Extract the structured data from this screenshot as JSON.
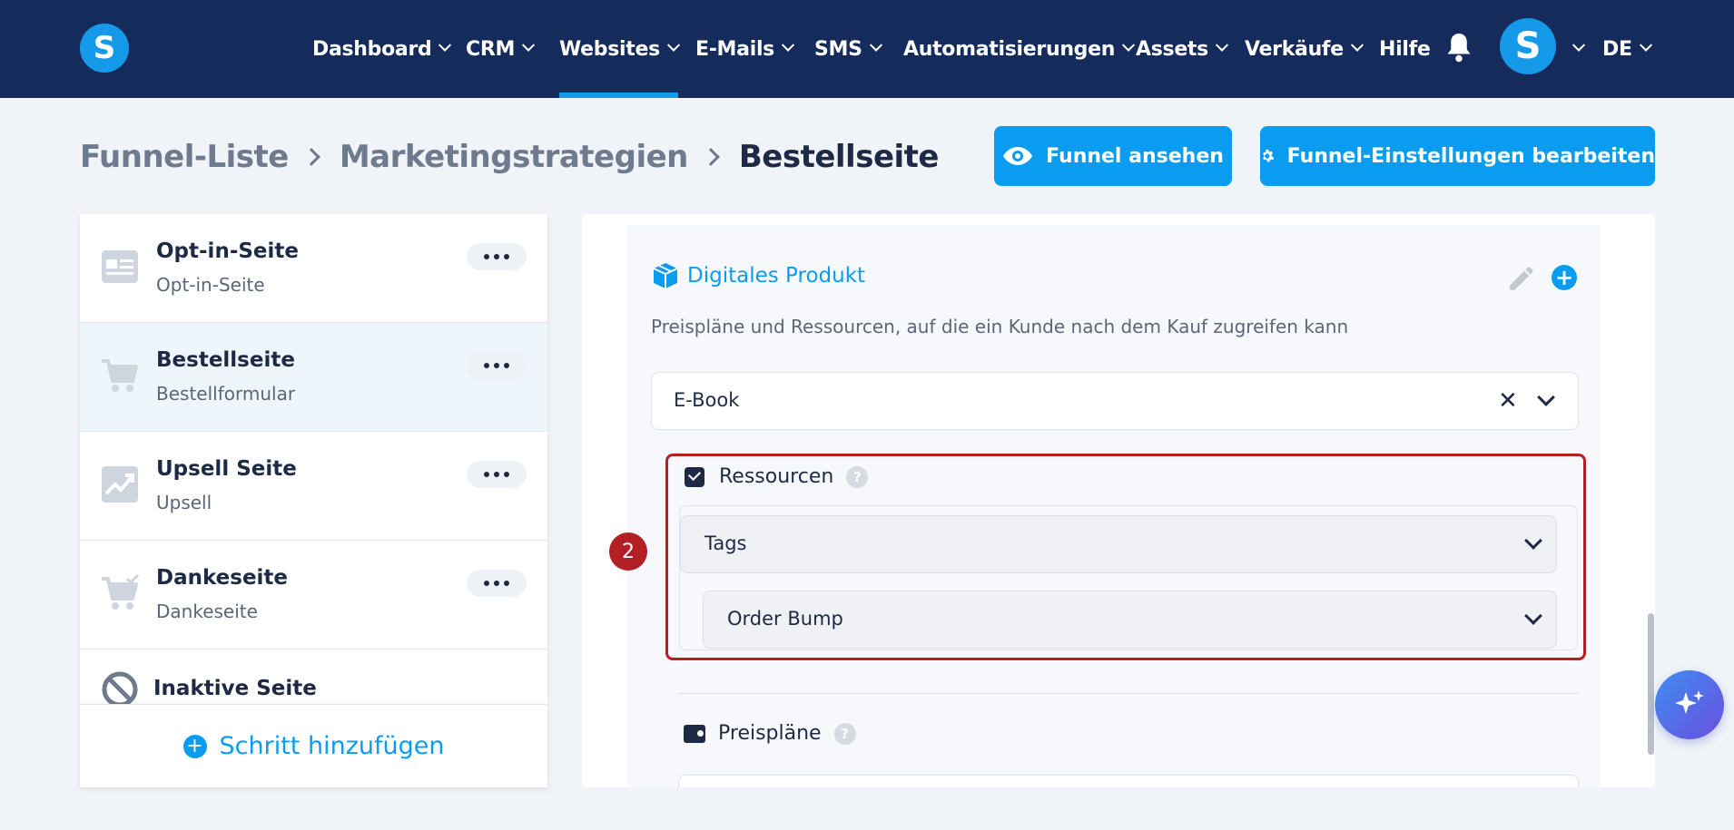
{
  "nav": {
    "logo": "S",
    "items": [
      {
        "label": "Dashboard"
      },
      {
        "label": "CRM"
      },
      {
        "label": "Websites"
      },
      {
        "label": "E-Mails"
      },
      {
        "label": "SMS"
      },
      {
        "label": "Automatisierungen"
      },
      {
        "label": "Assets"
      },
      {
        "label": "Verkäufe"
      },
      {
        "label": "Hilfe"
      }
    ],
    "active": "Websites",
    "avatar": "S",
    "language": "DE"
  },
  "breadcrumb": {
    "items": [
      "Funnel-Liste",
      "Marketingstrategien"
    ],
    "current": "Bestellseite"
  },
  "actions": {
    "view_funnel": "Funnel ansehen",
    "edit_settings": "Funnel-Einstellungen bearbeiten"
  },
  "steps": [
    {
      "title": "Opt-in-Seite",
      "subtitle": "Opt-in-Seite",
      "icon": "form-page-icon"
    },
    {
      "title": "Bestellseite",
      "subtitle": "Bestellformular",
      "icon": "cart-icon",
      "active": true
    },
    {
      "title": "Upsell Seite",
      "subtitle": "Upsell",
      "icon": "trending-up-icon"
    },
    {
      "title": "Dankeseite",
      "subtitle": "Dankeseite",
      "icon": "cart-check-icon"
    },
    {
      "title": "Inaktive Seite",
      "subtitle": "",
      "icon": "ban-icon"
    }
  ],
  "add_step_label": "Schritt hinzufügen",
  "product_section": {
    "title": "Digitales Produkt",
    "description": "Preispläne und Ressourcen, auf die ein Kunde nach dem Kauf zugreifen kann",
    "selected_product": "E-Book",
    "resources": {
      "title": "Ressourcen",
      "help": "?",
      "tags_label": "Tags",
      "order_bump_label": "Order Bump"
    },
    "step_badge": "2",
    "price_plans": {
      "title": "Preispläne",
      "help": "?"
    }
  },
  "colors": {
    "nav_bg": "#142b5c",
    "accent": "#0a9cf0",
    "highlight": "#b21f24"
  }
}
